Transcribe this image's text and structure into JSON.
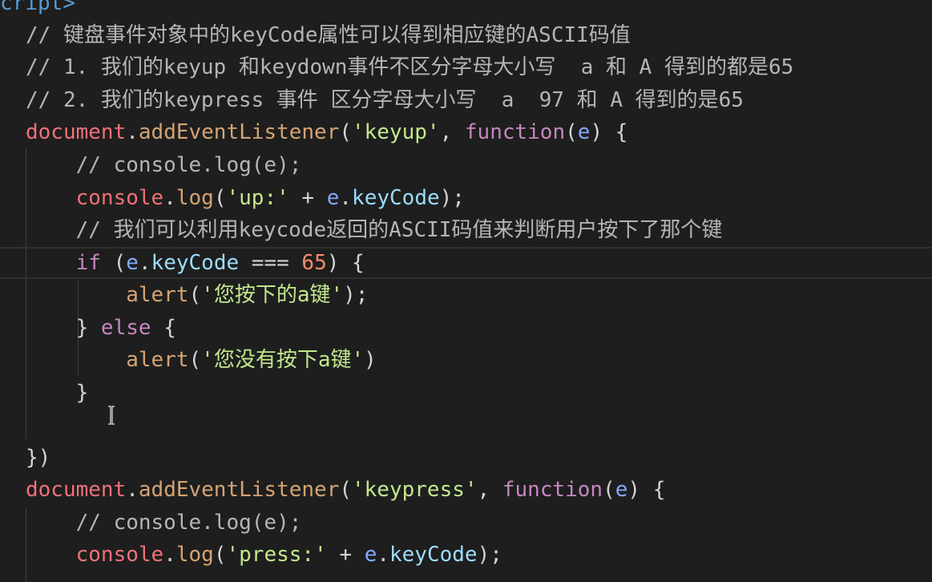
{
  "lines": [
    {
      "id": "l0",
      "parts": [
        [
          "tag",
          "cript>"
        ]
      ]
    },
    {
      "id": "l1",
      "parts": [
        [
          "cm",
          "// 键盘事件对象中的keyCode属性可以得到相应键的ASCII码值"
        ]
      ]
    },
    {
      "id": "l2",
      "parts": [
        [
          "cm",
          "// 1. 我们的keyup 和keydown事件不区分字母大小写  a 和 A 得到的都是65"
        ]
      ]
    },
    {
      "id": "l3",
      "parts": [
        [
          "cm",
          "// 2. 我们的keypress 事件 区分字母大小写  a  97 和 A 得到的是65"
        ]
      ]
    },
    {
      "id": "l4",
      "parts": [
        [
          "obj",
          "document"
        ],
        [
          "pun",
          "."
        ],
        [
          "fn",
          "addEventListener"
        ],
        [
          "pun",
          "("
        ],
        [
          "str",
          "'keyup'"
        ],
        [
          "pun",
          ", "
        ],
        [
          "kw",
          "function"
        ],
        [
          "pun",
          "("
        ],
        [
          "var",
          "e"
        ],
        [
          "pun",
          ") {"
        ]
      ]
    },
    {
      "id": "l5",
      "parts": [
        [
          "cm",
          "    // console.log(e);"
        ]
      ]
    },
    {
      "id": "l6",
      "parts": [
        [
          "pun",
          "    "
        ],
        [
          "obj",
          "console"
        ],
        [
          "pun",
          "."
        ],
        [
          "fn",
          "log"
        ],
        [
          "pun",
          "("
        ],
        [
          "str",
          "'up:'"
        ],
        [
          "pun",
          " + "
        ],
        [
          "var",
          "e"
        ],
        [
          "pun",
          "."
        ],
        [
          "prop",
          "keyCode"
        ],
        [
          "pun",
          ");"
        ]
      ]
    },
    {
      "id": "l7",
      "parts": [
        [
          "cm",
          "    // 我们可以利用keycode返回的ASCII码值来判断用户按下了那个键"
        ]
      ]
    },
    {
      "id": "l8",
      "parts": [
        [
          "pun",
          "    "
        ],
        [
          "kw",
          "if"
        ],
        [
          "pun",
          " ("
        ],
        [
          "var",
          "e"
        ],
        [
          "pun",
          "."
        ],
        [
          "prop",
          "keyCode"
        ],
        [
          "pun",
          " === "
        ],
        [
          "num",
          "65"
        ],
        [
          "pun",
          ") {"
        ]
      ]
    },
    {
      "id": "l9",
      "parts": [
        [
          "pun",
          "        "
        ],
        [
          "fn",
          "alert"
        ],
        [
          "pun",
          "("
        ],
        [
          "str",
          "'您按下的a键'"
        ],
        [
          "pun",
          ");"
        ]
      ]
    },
    {
      "id": "l10",
      "parts": [
        [
          "pun",
          "    } "
        ],
        [
          "kw",
          "else"
        ],
        [
          "pun",
          " {"
        ]
      ]
    },
    {
      "id": "l11",
      "parts": [
        [
          "pun",
          "        "
        ],
        [
          "fn",
          "alert"
        ],
        [
          "pun",
          "("
        ],
        [
          "str",
          "'您没有按下a键'"
        ],
        [
          "pun",
          ")"
        ]
      ]
    },
    {
      "id": "l12",
      "parts": [
        [
          "pun",
          "    }"
        ]
      ]
    },
    {
      "id": "l13",
      "parts": []
    },
    {
      "id": "l14",
      "parts": [
        [
          "pun",
          "})"
        ]
      ]
    },
    {
      "id": "l15",
      "parts": [
        [
          "obj",
          "document"
        ],
        [
          "pun",
          "."
        ],
        [
          "fn",
          "addEventListener"
        ],
        [
          "pun",
          "("
        ],
        [
          "str",
          "'keypress'"
        ],
        [
          "pun",
          ", "
        ],
        [
          "kw",
          "function"
        ],
        [
          "pun",
          "("
        ],
        [
          "var",
          "e"
        ],
        [
          "pun",
          ") {"
        ]
      ]
    },
    {
      "id": "l16",
      "parts": [
        [
          "cm",
          "    // console.log(e);"
        ]
      ]
    },
    {
      "id": "l17",
      "parts": [
        [
          "pun",
          "    "
        ],
        [
          "obj",
          "console"
        ],
        [
          "pun",
          "."
        ],
        [
          "fn",
          "log"
        ],
        [
          "pun",
          "("
        ],
        [
          "str",
          "'press:'"
        ],
        [
          "pun",
          " + "
        ],
        [
          "var",
          "e"
        ],
        [
          "pun",
          "."
        ],
        [
          "prop",
          "keyCode"
        ],
        [
          "pun",
          ");"
        ]
      ]
    }
  ],
  "current_line": "l8",
  "colors": {
    "background": "#1e1e1e",
    "comment": "#b5b5b5",
    "keyword": "#c586c0",
    "function": "#d4a373",
    "object": "#f07178",
    "string": "#c3e88d",
    "number": "#f78c6c"
  },
  "cursor_icon": "text-ibeam-icon"
}
